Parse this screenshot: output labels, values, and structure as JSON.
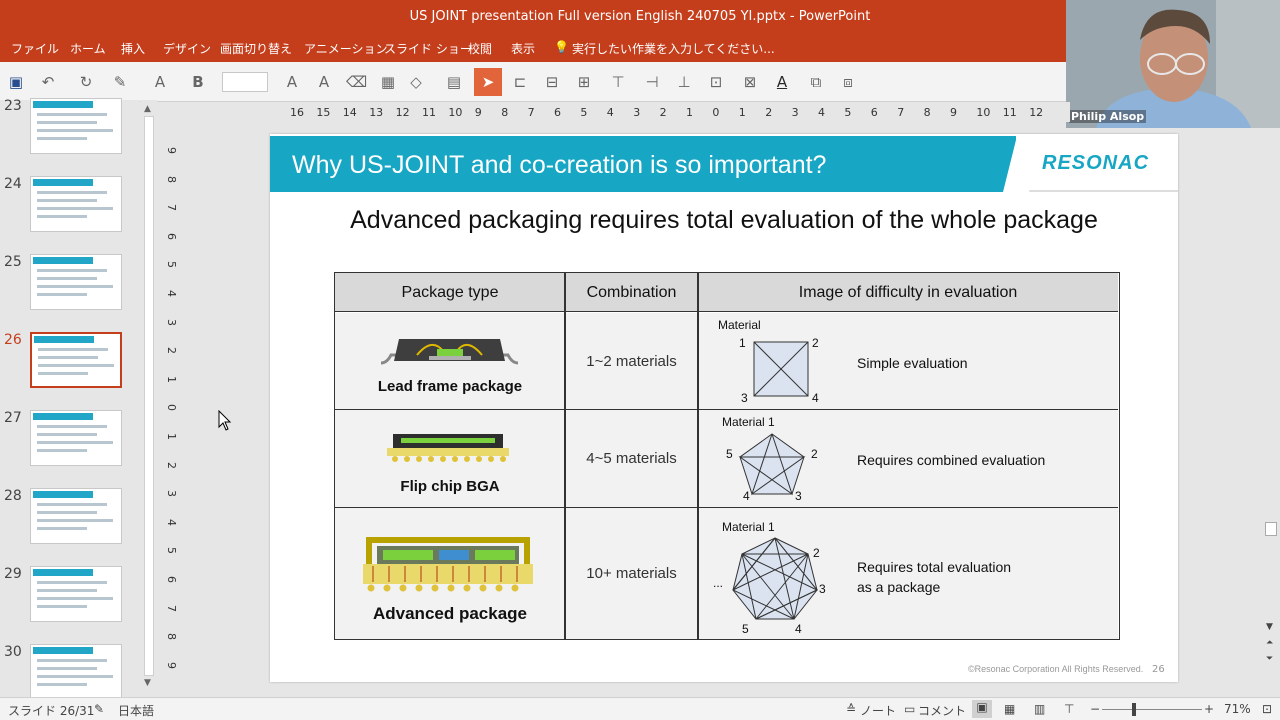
{
  "window": {
    "title": "US JOINT presentation Full version  English 240705 YI.pptx - PowerPoint"
  },
  "menu": {
    "items": [
      "ファイル",
      "ホーム",
      "挿入",
      "デザイン",
      "画面切り替え",
      "アニメーション",
      "スライド ショー",
      "校閲",
      "表示"
    ],
    "search_placeholder": "実行したい作業を入力してください..."
  },
  "webcam": {
    "name": "Philip Alsop"
  },
  "ruler": {
    "h_ticks": [
      "16",
      "15",
      "14",
      "13",
      "12",
      "11",
      "10",
      "9",
      "8",
      "7",
      "6",
      "5",
      "4",
      "3",
      "2",
      "1",
      "0",
      "1",
      "2",
      "3",
      "4",
      "5",
      "6",
      "7",
      "8",
      "9",
      "10",
      "11",
      "12"
    ],
    "v_ticks": [
      "9",
      "8",
      "7",
      "6",
      "5",
      "4",
      "3",
      "2",
      "1",
      "0",
      "1",
      "2",
      "3",
      "4",
      "5",
      "6",
      "7",
      "8",
      "9"
    ]
  },
  "thumbnails": [
    {
      "num": "23",
      "selected": false
    },
    {
      "num": "24",
      "selected": false
    },
    {
      "num": "25",
      "selected": false
    },
    {
      "num": "26",
      "selected": true
    },
    {
      "num": "27",
      "selected": false
    },
    {
      "num": "28",
      "selected": false
    },
    {
      "num": "29",
      "selected": false
    },
    {
      "num": "30",
      "selected": false
    }
  ],
  "slide": {
    "header_title": "Why US-JOINT and co-creation is so important?",
    "logo": "RESONAC",
    "subtitle": "Advanced packaging requires total evaluation of the whole package",
    "table": {
      "headers": [
        "Package type",
        "Combination",
        "Image of difficulty in evaluation"
      ],
      "rows": [
        {
          "package": "Lead frame package",
          "combination": "1~2 materials",
          "evaluation": "Simple evaluation",
          "labels": {
            "material": "Material",
            "n1": "1",
            "n2": "2",
            "n3": "3",
            "n4": "4"
          }
        },
        {
          "package": "Flip chip BGA",
          "combination": "4~5 materials",
          "evaluation": "Requires combined evaluation",
          "labels": {
            "material": "Material 1",
            "n2": "2",
            "n3": "3",
            "n4": "4",
            "n5": "5"
          }
        },
        {
          "package": "Advanced package",
          "combination": "10+ materials",
          "evaluation_line1": "Requires total evaluation",
          "evaluation_line2": "as a package",
          "labels": {
            "material": "Material 1",
            "n2": "2",
            "n3": "3",
            "n4": "4",
            "n5": "5",
            "dots": "..."
          }
        }
      ]
    },
    "copyright": "©Resonac Corporation All Rights Reserved.",
    "page_number": "26"
  },
  "status": {
    "slide_info": "スライド 26/31",
    "language": "日本語",
    "notes": "ノート",
    "comments": "コメント",
    "zoom": "71%"
  },
  "colors": {
    "brand": "#c43e1c",
    "header_blue": "#17a6c4"
  }
}
